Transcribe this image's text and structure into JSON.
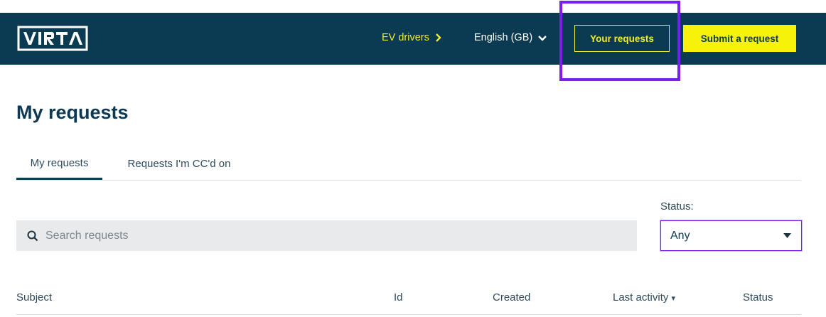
{
  "header": {
    "logo_text": "VIRTA",
    "nav_ev_drivers": "EV drivers",
    "nav_language": "English (GB)",
    "your_requests_label": "Your requests",
    "submit_request_label": "Submit a request"
  },
  "main": {
    "title": "My requests",
    "tabs": [
      {
        "label": "My requests",
        "active": true
      },
      {
        "label": "Requests I'm CC'd on",
        "active": false
      }
    ],
    "search": {
      "placeholder": "Search requests",
      "value": ""
    },
    "status_filter": {
      "label": "Status:",
      "value": "Any"
    },
    "table": {
      "columns": [
        "Subject",
        "Id",
        "Created",
        "Last activity",
        "Status"
      ],
      "sort_indicator": "▾"
    }
  },
  "colors": {
    "header_bg": "#0b3a53",
    "accent_yellow": "#f7f20a",
    "highlight_purple": "#7b1ff0"
  },
  "icons": [
    "chevron-right-icon",
    "chevron-down-icon",
    "search-icon",
    "caret-down-icon"
  ]
}
